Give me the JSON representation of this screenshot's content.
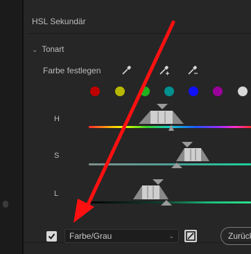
{
  "panel": {
    "title": "HSL Sekundär",
    "section": {
      "label": "Tonart"
    },
    "target_color": {
      "label": "Farbe festlegen",
      "pickers": [
        "eyedropper-icon",
        "eyedropper-add-icon",
        "eyedropper-subtract-icon"
      ],
      "swatches": [
        "#c00000",
        "#b8b800",
        "#20b020",
        "#009090",
        "#1010ff",
        "#9a009a",
        "#d8d8d8"
      ]
    },
    "sliders": [
      {
        "label": "H"
      },
      {
        "label": "S"
      },
      {
        "label": "L"
      }
    ],
    "footer": {
      "checkbox_checked": true,
      "mode_select": "Farbe/Grau",
      "swap_icon": "swap-icon",
      "reset_label": "Zurück"
    }
  }
}
